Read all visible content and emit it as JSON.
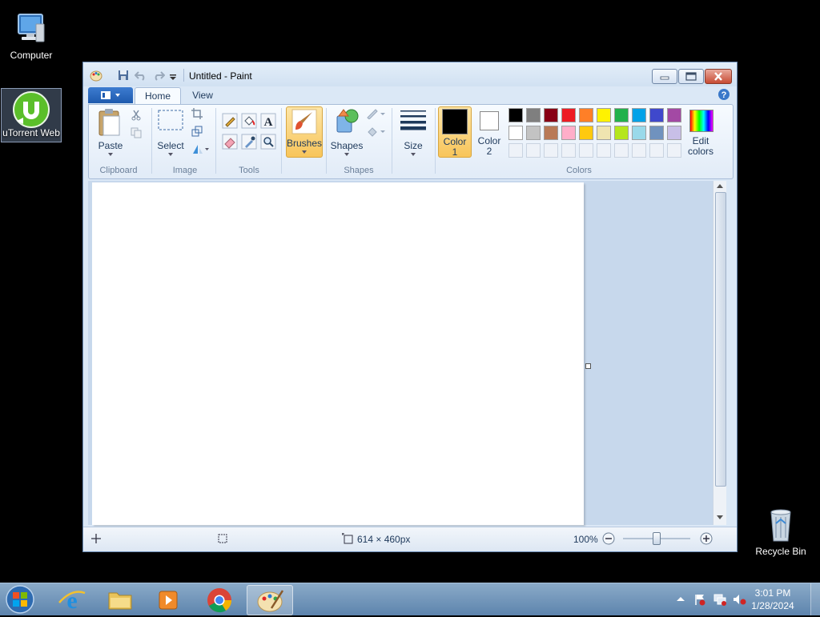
{
  "desktop": {
    "icons": [
      {
        "label": "Computer",
        "icon": "computer-icon"
      },
      {
        "label": "uTorrent Web",
        "icon": "utorrent-icon"
      },
      {
        "label": "Recycle Bin",
        "icon": "recycle-bin-icon"
      }
    ]
  },
  "window": {
    "title": "Untitled - Paint",
    "tabs": [
      {
        "label": "Home",
        "active": true
      },
      {
        "label": "View",
        "active": false
      }
    ]
  },
  "ribbon": {
    "clipboard": {
      "group_label": "Clipboard",
      "paste_label": "Paste"
    },
    "image": {
      "group_label": "Image",
      "select_label": "Select"
    },
    "tools": {
      "group_label": "Tools"
    },
    "brushes": {
      "label": "Brushes"
    },
    "shapes": {
      "group_label": "Shapes",
      "shapes_label": "Shapes"
    },
    "size": {
      "label": "Size"
    },
    "colors": {
      "group_label": "Colors",
      "color1_label_a": "Color",
      "color1_label_b": "1",
      "color2_label_a": "Color",
      "color2_label_b": "2",
      "edit_label_a": "Edit",
      "edit_label_b": "colors",
      "color1_value": "#000000",
      "color2_value": "#ffffff",
      "palette_row1": [
        "#000000",
        "#7f7f7f",
        "#880015",
        "#ed1c24",
        "#ff7f27",
        "#fff200",
        "#22b14c",
        "#00a2e8",
        "#3f48cc",
        "#a349a4"
      ],
      "palette_row2": [
        "#ffffff",
        "#c3c3c3",
        "#b97a57",
        "#ffaec9",
        "#ffc90e",
        "#efe4b0",
        "#b5e61d",
        "#99d9ea",
        "#7092be",
        "#c8bfe7"
      ]
    }
  },
  "status": {
    "canvas_size": "614 × 460px",
    "zoom": "100%"
  },
  "taskbar": {
    "time": "3:01 PM",
    "date": "1/28/2024"
  }
}
